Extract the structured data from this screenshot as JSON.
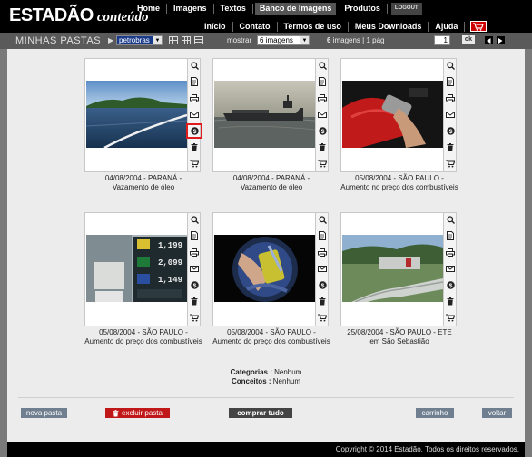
{
  "logo": {
    "part1": "ESTADÃO",
    "part2": "conteúdo"
  },
  "nav_top": [
    "Home",
    "Imagens",
    "Textos",
    "Banco de Imagens",
    "Produtos"
  ],
  "nav_top_active": "Banco de Imagens",
  "logout_label": "LOGOUT",
  "nav_bottom": [
    "Início",
    "Contato",
    "Termos de uso",
    "Meus Downloads",
    "Ajuda"
  ],
  "toolbar": {
    "title": "MINHAS PASTAS",
    "folder_selected": "petrobras",
    "show_label": "mostrar",
    "per_page_selected": "6 imagens",
    "count_number": "6",
    "count_suffix": "imagens | 1 pág",
    "page_value": "1",
    "ok_label": "ok"
  },
  "images": [
    {
      "date_place": "04/08/2004 - PARANÁ -",
      "caption": "Vazamento de óleo"
    },
    {
      "date_place": "04/08/2004 - PARANÁ -",
      "caption": "Vazamento de óleo"
    },
    {
      "date_place": "05/08/2004 - SÃO PAULO -",
      "caption": "Aumento no preço dos combustíveis"
    },
    {
      "date_place": "05/08/2004 - SÃO PAULO -",
      "caption": "Aumento do preço dos combustíveis"
    },
    {
      "date_place": "05/08/2004 - SÃO PAULO -",
      "caption": "Aumento do preço dos combustíveis"
    },
    {
      "date_place": "25/08/2004 - SÃO PAULO - ETE",
      "caption": "em São Sebastião"
    }
  ],
  "pump_prices": [
    "1,199",
    "2,099",
    "1,149"
  ],
  "meta": {
    "categories_label": "Categorias :",
    "categories_value": "Nenhum",
    "concepts_label": "Conceitos :",
    "concepts_value": "Nenhum"
  },
  "buttons": {
    "new_folder": "nova pasta",
    "delete_folder": "excluir pasta",
    "buy_all": "comprar tudo",
    "cart": "carrinho",
    "back": "voltar"
  },
  "footer": "Copyright © 2014 Estadão. Todos os direitos reservados.",
  "colors": {
    "header_bg": "#000000",
    "toolbar_bg": "#5a5a5a",
    "content_bg": "#ececec",
    "highlight": "#e01c1c",
    "delete_button": "#c01818",
    "neutral_button": "#6f7f8f"
  }
}
